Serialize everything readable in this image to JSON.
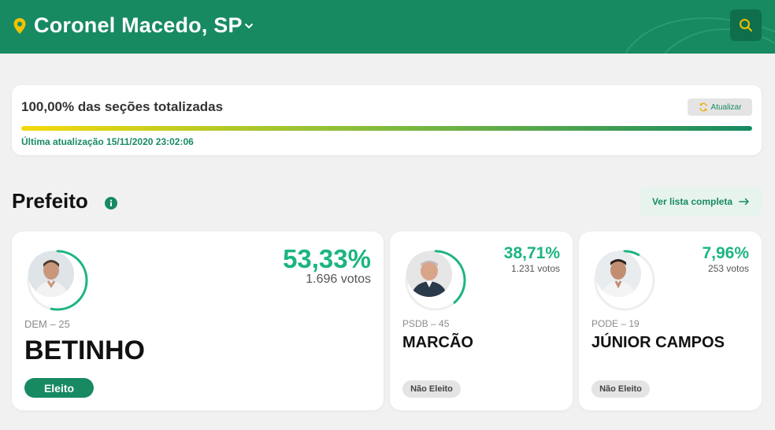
{
  "header": {
    "city": "Coronel Macedo, SP",
    "location_icon": "map-pin-icon",
    "dropdown_icon": "chevron-down-icon",
    "search_icon": "search-icon"
  },
  "status": {
    "title": "100,00% das seções totalizadas",
    "progress_percent": 100,
    "refresh_label": "Atualizar",
    "last_update": "Última atualização 15/11/2020 23:02:06"
  },
  "section": {
    "title": "Prefeito",
    "list_button": "Ver lista completa"
  },
  "candidates": [
    {
      "party": "DEM – 25",
      "name": "BETINHO",
      "percent": "53,33%",
      "percent_value": 53.33,
      "votes": "1.696 votos",
      "status": "Eleito",
      "elected": true
    },
    {
      "party": "PSDB – 45",
      "name": "MARCÃO",
      "percent": "38,71%",
      "percent_value": 38.71,
      "votes": "1.231 votos",
      "status": "Não Eleito",
      "elected": false
    },
    {
      "party": "PODE – 19",
      "name": "JÚNIOR CAMPOS",
      "percent": "7,96%",
      "percent_value": 7.96,
      "votes": "253 votos",
      "status": "Não Eleito",
      "elected": false
    }
  ],
  "colors": {
    "brand": "#178a62",
    "brand_dark": "#0f6e4b",
    "accent_yellow": "#f2c200",
    "percent_green": "#1cb57f"
  }
}
